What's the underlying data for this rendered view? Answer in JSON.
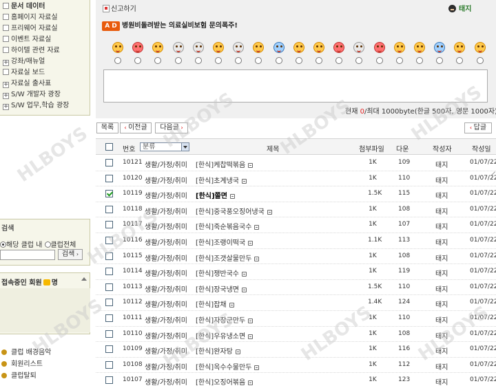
{
  "sidebar": {
    "menu": [
      {
        "label": "문서 데이터",
        "icon": "square-icon",
        "bold": true
      },
      {
        "label": "홈페이지 자료실",
        "icon": "square-icon"
      },
      {
        "label": "프리웨어 자료실",
        "icon": "square-icon"
      },
      {
        "label": "이벤트 자료실",
        "icon": "square-icon"
      },
      {
        "label": "하이텔 관련 자료",
        "icon": "square-icon"
      },
      {
        "label": "강좌/매뉴얼",
        "icon": "plus-box-icon"
      },
      {
        "label": "자료실 보드",
        "icon": "square-icon"
      },
      {
        "label": "자료실 출사표",
        "icon": "plus-box-icon"
      },
      {
        "label": "S/W 개발자 광장",
        "icon": "plus-box-icon"
      },
      {
        "label": "S/W 업무,학습 광장",
        "icon": "plus-box-icon"
      }
    ],
    "search": {
      "title": "검색",
      "option_club": "해당 클럽 내",
      "option_all": "클럽전체",
      "button": "검색"
    },
    "online": {
      "title": "접속중인 회원",
      "count_suffix": "명"
    },
    "extra_links": [
      "클럽 배경음악",
      "회원리스트",
      "클럽탈퇴"
    ]
  },
  "top": {
    "report_label": "신고하기",
    "user_name": "태지"
  },
  "ad": {
    "badge": "A D",
    "text": "병원비돌려받는 의료실비보험 문의폭주!"
  },
  "comment": {
    "counter_prefix": "현재 ",
    "counter_value": "0",
    "counter_suffix": "/최대 1000byte(한글 500자, 영문 1000자)"
  },
  "toolbar": {
    "list": "목록",
    "prev": "이전글",
    "next": "다음글",
    "reply": "답글"
  },
  "table": {
    "headers": {
      "no": "번호",
      "category_select": "분류",
      "title": "제목",
      "attachment": "첨부파일",
      "downloads": "다운",
      "writer": "작성자",
      "date": "작성일"
    },
    "rows": [
      {
        "no": "10121",
        "category": "생활/가정/취미",
        "title": "[한식]케찹떡볶음",
        "file": "1K",
        "down": "109",
        "writer": "태지",
        "date": "01/07/22",
        "checked": false
      },
      {
        "no": "10120",
        "category": "생활/가정/취미",
        "title": "[한식]초계냉국",
        "file": "1K",
        "down": "110",
        "writer": "태지",
        "date": "01/07/22",
        "checked": false
      },
      {
        "no": "10119",
        "category": "생활/가정/취미",
        "title": "[한식]쫄면",
        "file": "1.5K",
        "down": "115",
        "writer": "태지",
        "date": "01/07/22",
        "checked": true
      },
      {
        "no": "10118",
        "category": "생활/가정/취미",
        "title": "[한식]중국풍오징어냉국",
        "file": "1K",
        "down": "108",
        "writer": "태지",
        "date": "01/07/22",
        "checked": false
      },
      {
        "no": "10117",
        "category": "생활/가정/취미",
        "title": "[한식]죽순볶음국수",
        "file": "1K",
        "down": "107",
        "writer": "태지",
        "date": "01/07/22",
        "checked": false
      },
      {
        "no": "10116",
        "category": "생활/가정/취미",
        "title": "[한식]조랭이떡국",
        "file": "1.1K",
        "down": "113",
        "writer": "태지",
        "date": "01/07/22",
        "checked": false
      },
      {
        "no": "10115",
        "category": "생활/가정/취미",
        "title": "[한식]조갯살물만두",
        "file": "1K",
        "down": "108",
        "writer": "태지",
        "date": "01/07/22",
        "checked": false
      },
      {
        "no": "10114",
        "category": "생활/가정/취미",
        "title": "[한식]쟁반국수",
        "file": "1K",
        "down": "119",
        "writer": "태지",
        "date": "01/07/22",
        "checked": false
      },
      {
        "no": "10113",
        "category": "생활/가정/취미",
        "title": "[한식]장국냉면",
        "file": "1.5K",
        "down": "110",
        "writer": "태지",
        "date": "01/07/22",
        "checked": false
      },
      {
        "no": "10112",
        "category": "생활/가정/취미",
        "title": "[한식]잡채",
        "file": "1.4K",
        "down": "124",
        "writer": "태지",
        "date": "01/07/22",
        "checked": false
      },
      {
        "no": "10111",
        "category": "생활/가정/취미",
        "title": "[한식]자장군만두",
        "file": "1K",
        "down": "110",
        "writer": "태지",
        "date": "01/07/22",
        "checked": false
      },
      {
        "no": "10110",
        "category": "생활/가정/취미",
        "title": "[한식]우유냉소면",
        "file": "1K",
        "down": "108",
        "writer": "태지",
        "date": "01/07/22",
        "checked": false
      },
      {
        "no": "10109",
        "category": "생활/가정/취미",
        "title": "[한식]완자탕",
        "file": "1K",
        "down": "116",
        "writer": "태지",
        "date": "01/07/22",
        "checked": false
      },
      {
        "no": "10108",
        "category": "생활/가정/취미",
        "title": "[한식]옥수수물만두",
        "file": "1K",
        "down": "112",
        "writer": "태지",
        "date": "01/07/22",
        "checked": false
      },
      {
        "no": "10107",
        "category": "생활/가정/취미",
        "title": "[한식]오징어볶음",
        "file": "1K",
        "down": "123",
        "writer": "태지",
        "date": "01/07/22",
        "checked": false
      }
    ]
  },
  "watermark": "HLBOYS",
  "colors": {
    "accent_red": "#e21f1f",
    "ad_orange": "#e85a0c",
    "panel_beige": "#f6f6ea"
  }
}
